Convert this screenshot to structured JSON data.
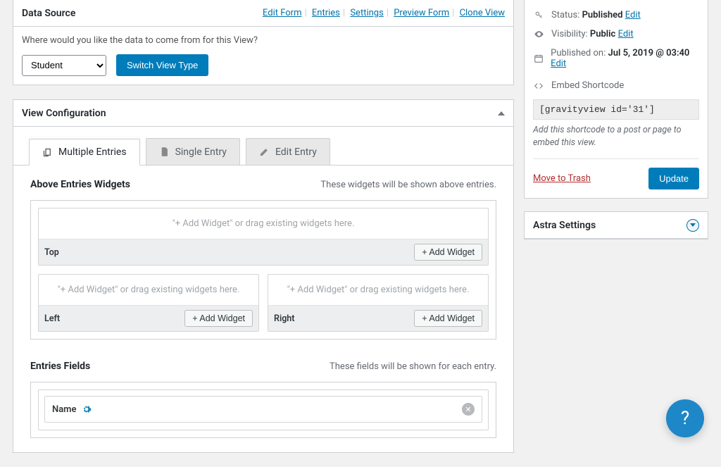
{
  "data_source": {
    "title": "Data Source",
    "links": {
      "edit_form": "Edit Form",
      "entries": "Entries",
      "settings": "Settings",
      "preview_form": "Preview Form",
      "clone_view": "Clone View"
    },
    "question": "Where would you like the data to come from for this View?",
    "select_value": "Student",
    "switch_button": "Switch View Type"
  },
  "view_config": {
    "title": "View Configuration",
    "tabs": {
      "multiple": "Multiple Entries",
      "single": "Single Entry",
      "edit": "Edit Entry"
    },
    "above_widgets": {
      "heading": "Above Entries Widgets",
      "hint": "These widgets will be shown above entries.",
      "drop_hint": "\"+ Add Widget\" or drag existing widgets here.",
      "zones": {
        "top": "Top",
        "left": "Left",
        "right": "Right"
      },
      "add_button": "+ Add Widget"
    },
    "entries_fields": {
      "heading": "Entries Fields",
      "hint": "These fields will be shown for each entry.",
      "field_name": "Name"
    }
  },
  "publish": {
    "status_label": "Status:",
    "status_value": "Published",
    "visibility_label": "Visibility:",
    "visibility_value": "Public",
    "published_label": "Published on:",
    "published_value": "Jul 5, 2019 @ 03:40",
    "edit": "Edit",
    "embed_label": "Embed Shortcode",
    "shortcode": "[gravityview id='31']",
    "shortcode_hint": "Add this shortcode to a post or page to embed this view.",
    "trash": "Move to Trash",
    "update": "Update"
  },
  "astra": {
    "title": "Astra Settings"
  },
  "help_fab": "?"
}
